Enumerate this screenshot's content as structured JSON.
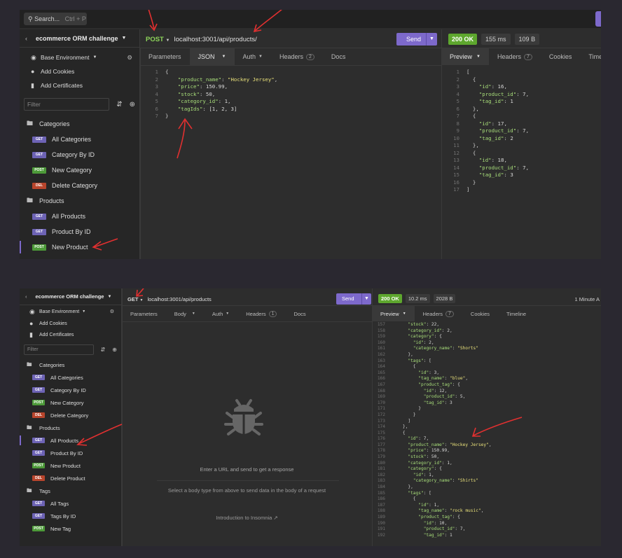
{
  "top": {
    "search": {
      "label": "Search...",
      "shortcut": "Ctrl + P"
    },
    "workspace": "ecommerce ORM challenge",
    "sidebar": {
      "environment": "Base Environment",
      "add_cookies": "Add Cookies",
      "add_certificates": "Add Certificates",
      "filter_placeholder": "Filter",
      "folder_categories": "Categories",
      "categories": [
        {
          "method": "GET",
          "label": "All Categories"
        },
        {
          "method": "GET",
          "label": "Category By ID"
        },
        {
          "method": "POST",
          "label": "New Category"
        },
        {
          "method": "DEL",
          "label": "Delete Category"
        }
      ],
      "folder_products": "Products",
      "products": [
        {
          "method": "GET",
          "label": "All Products"
        },
        {
          "method": "GET",
          "label": "Product By ID"
        },
        {
          "method": "POST",
          "label": "New Product"
        }
      ]
    },
    "request": {
      "method": "POST",
      "url": "localhost:3001/api/products/",
      "send": "Send",
      "tabs": {
        "parameters": "Parameters",
        "json": "JSON",
        "auth": "Auth",
        "headers": "Headers",
        "headers_count": "2",
        "docs": "Docs"
      },
      "body_lines": [
        {
          "n": "1",
          "t": "{"
        },
        {
          "n": "2",
          "k": "\"product_name\"",
          "v": "\"Hockey Jersey\"",
          "type": "s",
          "end": ","
        },
        {
          "n": "3",
          "k": "\"price\"",
          "v": "150.99",
          "type": "n",
          "end": ","
        },
        {
          "n": "4",
          "k": "\"stock\"",
          "v": "50",
          "type": "n",
          "end": ","
        },
        {
          "n": "5",
          "k": "\"category_id\"",
          "v": "1",
          "type": "n",
          "end": ","
        },
        {
          "n": "6",
          "k": "\"tagIds\"",
          "v": "[1, 2, 3]",
          "type": "n",
          "end": ""
        },
        {
          "n": "7",
          "t": "}"
        }
      ]
    },
    "response": {
      "status": "200 OK",
      "time": "155 ms",
      "size": "109 B",
      "tabs": {
        "preview": "Preview",
        "headers": "Headers",
        "headers_count": "7",
        "cookies": "Cookies",
        "timeline": "Timeline"
      },
      "lines": [
        {
          "n": "1",
          "t": "["
        },
        {
          "n": "2",
          "t": "  {"
        },
        {
          "n": "3",
          "k": "\"id\"",
          "v": "16",
          "ind": 4,
          "end": ","
        },
        {
          "n": "4",
          "k": "\"product_id\"",
          "v": "7",
          "ind": 4,
          "end": ","
        },
        {
          "n": "5",
          "k": "\"tag_id\"",
          "v": "1",
          "ind": 4,
          "end": ""
        },
        {
          "n": "6",
          "t": "  },"
        },
        {
          "n": "7",
          "t": "  {"
        },
        {
          "n": "8",
          "k": "\"id\"",
          "v": "17",
          "ind": 4,
          "end": ","
        },
        {
          "n": "9",
          "k": "\"product_id\"",
          "v": "7",
          "ind": 4,
          "end": ","
        },
        {
          "n": "10",
          "k": "\"tag_id\"",
          "v": "2",
          "ind": 4,
          "end": ""
        },
        {
          "n": "11",
          "t": "  },"
        },
        {
          "n": "12",
          "t": "  {"
        },
        {
          "n": "13",
          "k": "\"id\"",
          "v": "18",
          "ind": 4,
          "end": ","
        },
        {
          "n": "14",
          "k": "\"product_id\"",
          "v": "7",
          "ind": 4,
          "end": ","
        },
        {
          "n": "15",
          "k": "\"tag_id\"",
          "v": "3",
          "ind": 4,
          "end": ""
        },
        {
          "n": "16",
          "t": "  }"
        },
        {
          "n": "17",
          "t": "]"
        }
      ]
    }
  },
  "bottom": {
    "workspace": "ecommerce ORM challenge",
    "sidebar": {
      "environment": "Base Environment",
      "add_cookies": "Add Cookies",
      "add_certificates": "Add Certificates",
      "filter_placeholder": "Filter",
      "folder_categories": "Categories",
      "categories": [
        {
          "method": "GET",
          "label": "All Categories"
        },
        {
          "method": "GET",
          "label": "Category By ID"
        },
        {
          "method": "POST",
          "label": "New Category"
        },
        {
          "method": "DEL",
          "label": "Delete Category"
        }
      ],
      "folder_products": "Products",
      "products": [
        {
          "method": "GET",
          "label": "All Products"
        },
        {
          "method": "GET",
          "label": "Product By ID"
        },
        {
          "method": "POST",
          "label": "New Product"
        },
        {
          "method": "DEL",
          "label": "Delete Product"
        }
      ],
      "folder_tags": "Tags",
      "tags": [
        {
          "method": "GET",
          "label": "All Tags"
        },
        {
          "method": "GET",
          "label": "Tags By ID"
        },
        {
          "method": "POST",
          "label": "New Tag"
        }
      ]
    },
    "request": {
      "method": "GET",
      "url": "localhost:3001/api/products",
      "send": "Send",
      "tabs": {
        "parameters": "Parameters",
        "body": "Body",
        "auth": "Auth",
        "headers": "Headers",
        "headers_count": "1",
        "docs": "Docs"
      },
      "empty_title": "Enter a URL and send to get a response",
      "empty_body": "Select a body type from above to send data in the body of a request",
      "intro_link": "Introduction to Insomnia"
    },
    "response": {
      "status": "200 OK",
      "time": "10.2 ms",
      "size": "2028 B",
      "time_ago": "1 Minute A",
      "tabs": {
        "preview": "Preview",
        "headers": "Headers",
        "headers_count": "7",
        "cookies": "Cookies",
        "timeline": "Timeline"
      },
      "lines": [
        {
          "n": "157",
          "k": "\"stock\"",
          "v": "22",
          "ind": 6,
          "end": ","
        },
        {
          "n": "158",
          "k": "\"category_id\"",
          "v": "2",
          "ind": 6,
          "end": ","
        },
        {
          "n": "159",
          "k": "\"category\"",
          "v": "{",
          "ind": 6,
          "end": ""
        },
        {
          "n": "160",
          "k": "\"id\"",
          "v": "2",
          "ind": 8,
          "end": ","
        },
        {
          "n": "161",
          "k": "\"category_name\"",
          "v": "\"Shorts\"",
          "ind": 8,
          "end": "",
          "str": true
        },
        {
          "n": "162",
          "t": "      },"
        },
        {
          "n": "163",
          "k": "\"tags\"",
          "v": "[",
          "ind": 6,
          "end": ""
        },
        {
          "n": "164",
          "t": "        {"
        },
        {
          "n": "165",
          "k": "\"id\"",
          "v": "3",
          "ind": 10,
          "end": ","
        },
        {
          "n": "166",
          "k": "\"tag_name\"",
          "v": "\"blue\"",
          "ind": 10,
          "end": ",",
          "str": true
        },
        {
          "n": "167",
          "k": "\"product_tag\"",
          "v": "{",
          "ind": 10,
          "end": ""
        },
        {
          "n": "168",
          "k": "\"id\"",
          "v": "12",
          "ind": 12,
          "end": ","
        },
        {
          "n": "169",
          "k": "\"product_id\"",
          "v": "5",
          "ind": 12,
          "end": ","
        },
        {
          "n": "170",
          "k": "\"tag_id\"",
          "v": "3",
          "ind": 12,
          "end": ""
        },
        {
          "n": "171",
          "t": "          }"
        },
        {
          "n": "172",
          "t": "        }"
        },
        {
          "n": "173",
          "t": "      ]"
        },
        {
          "n": "174",
          "t": "    },"
        },
        {
          "n": "175",
          "t": "    {"
        },
        {
          "n": "176",
          "k": "\"id\"",
          "v": "7",
          "ind": 6,
          "end": ","
        },
        {
          "n": "177",
          "k": "\"product_name\"",
          "v": "\"Hockey Jersey\"",
          "ind": 6,
          "end": ",",
          "str": true
        },
        {
          "n": "178",
          "k": "\"price\"",
          "v": "150.99",
          "ind": 6,
          "end": ","
        },
        {
          "n": "179",
          "k": "\"stock\"",
          "v": "50",
          "ind": 6,
          "end": ","
        },
        {
          "n": "180",
          "k": "\"category_id\"",
          "v": "1",
          "ind": 6,
          "end": ","
        },
        {
          "n": "181",
          "k": "\"category\"",
          "v": "{",
          "ind": 6,
          "end": ""
        },
        {
          "n": "182",
          "k": "\"id\"",
          "v": "1",
          "ind": 8,
          "end": ","
        },
        {
          "n": "183",
          "k": "\"category_name\"",
          "v": "\"Shirts\"",
          "ind": 8,
          "end": "",
          "str": true
        },
        {
          "n": "184",
          "t": "      },"
        },
        {
          "n": "185",
          "k": "\"tags\"",
          "v": "[",
          "ind": 6,
          "end": ""
        },
        {
          "n": "186",
          "t": "        {"
        },
        {
          "n": "187",
          "k": "\"id\"",
          "v": "1",
          "ind": 10,
          "end": ","
        },
        {
          "n": "188",
          "k": "\"tag_name\"",
          "v": "\"rock music\"",
          "ind": 10,
          "end": ",",
          "str": true
        },
        {
          "n": "189",
          "k": "\"product_tag\"",
          "v": "{",
          "ind": 10,
          "end": ""
        },
        {
          "n": "190",
          "k": "\"id\"",
          "v": "10",
          "ind": 12,
          "end": ","
        },
        {
          "n": "191",
          "k": "\"product_id\"",
          "v": "7",
          "ind": 12,
          "end": ","
        },
        {
          "n": "192",
          "k": "\"tag_id\"",
          "v": "1",
          "ind": 12,
          "end": ""
        }
      ]
    }
  }
}
